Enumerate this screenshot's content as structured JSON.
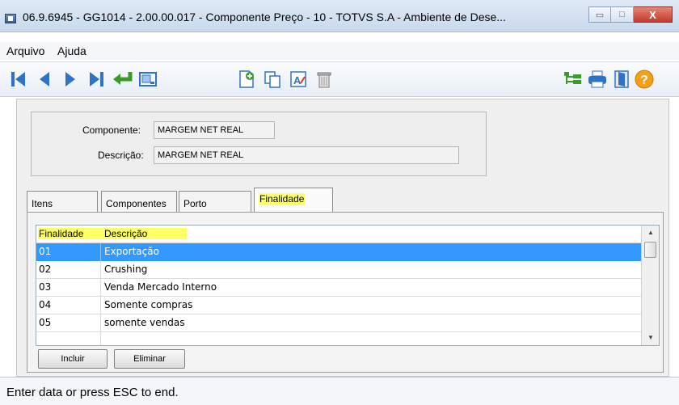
{
  "window": {
    "title": "06.9.6945 - GG1014 - 2.00.00.017 - Componente Preço - 10 - TOTVS S.A - Ambiente de Dese...",
    "controls": {
      "minimize": "▭",
      "maximize": "□",
      "close": "X"
    }
  },
  "menu": {
    "items": [
      "Arquivo",
      "Ajuda"
    ]
  },
  "toolbar": {
    "left_icons": [
      "first-record-icon",
      "previous-record-icon",
      "next-record-icon",
      "last-record-icon",
      "goto-enter-icon",
      "search-zoom-icon"
    ],
    "middle_icons": [
      "new-record-icon",
      "copy-record-icon",
      "edit-record-icon",
      "delete-record-icon"
    ],
    "right_icons": [
      "tree-navigator-icon",
      "print-icon",
      "exit-door-icon",
      "help-icon"
    ]
  },
  "form": {
    "componente_label": "Componente:",
    "componente_value": "MARGEM NET REAL",
    "descricao_label": "Descrição:",
    "descricao_value": "MARGEM NET REAL"
  },
  "tabs": [
    "Itens",
    "Componentes",
    "Porto",
    "Finalidade"
  ],
  "active_tab": "Finalidade",
  "grid": {
    "columns": [
      "Finalidade",
      "Descrição"
    ],
    "rows": [
      {
        "finalidade": "01",
        "descricao": "Exportação"
      },
      {
        "finalidade": "02",
        "descricao": "Crushing"
      },
      {
        "finalidade": "03",
        "descricao": "Venda Mercado Interno"
      },
      {
        "finalidade": "04",
        "descricao": "Somente compras"
      },
      {
        "finalidade": "05",
        "descricao": "somente vendas"
      }
    ],
    "selected_row": 0
  },
  "buttons": {
    "incluir": "Incluir",
    "eliminar": "Eliminar"
  },
  "status": {
    "text": "Enter data or press ESC to end."
  },
  "colors": {
    "selection": "#3399ff",
    "highlight": "#ffff66"
  }
}
